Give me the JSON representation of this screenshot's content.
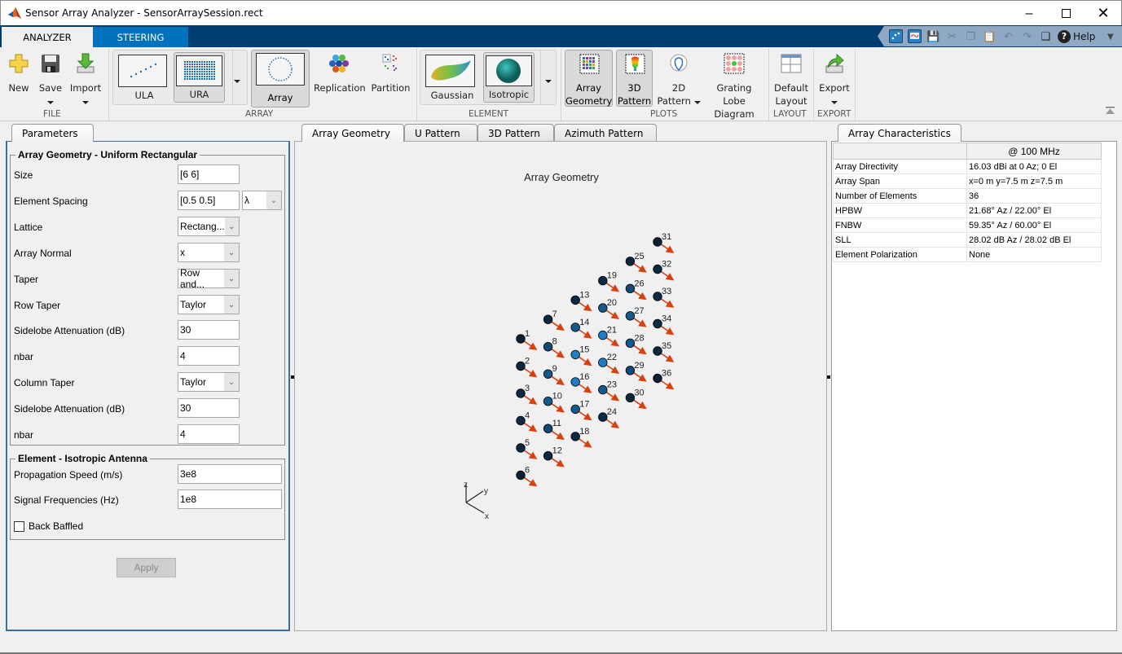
{
  "window": {
    "title": "Sensor Array Analyzer - SensorArraySession.rect",
    "minimize_icon": "minimize-icon",
    "maximize_icon": "maximize-icon",
    "close_icon": "close-icon"
  },
  "ribbon_tabs": [
    {
      "label": "ANALYZER",
      "active": true
    },
    {
      "label": "STEERING",
      "active": false
    }
  ],
  "quick_access": {
    "icons": [
      "array-geometry-plot-icon",
      "pattern-plot-icon",
      "save-icon",
      "cut-icon",
      "copy-icon",
      "paste-icon",
      "undo-icon",
      "redo-icon",
      "window-layout-icon"
    ],
    "help_label": "Help"
  },
  "ribbon": {
    "file": {
      "section": "FILE",
      "new": "New",
      "save": "Save",
      "import": "Import"
    },
    "array": {
      "section": "ARRAY",
      "gallery": [
        {
          "label": "ULA",
          "selected": false
        },
        {
          "label": "URA",
          "selected": true
        }
      ],
      "array_button": "Array",
      "replication": "Replication",
      "partition": "Partition"
    },
    "element": {
      "section": "ELEMENT",
      "gallery": [
        {
          "label": "Gaussian",
          "selected": false
        },
        {
          "label": "Isotropic",
          "selected": true
        }
      ]
    },
    "plots": {
      "section": "PLOTS",
      "array_geometry": [
        "Array",
        "Geometry"
      ],
      "pattern_3d": [
        "3D",
        "Pattern"
      ],
      "pattern_2d": [
        "2D",
        "Pattern"
      ],
      "grating_lobe": [
        "Grating Lobe",
        "Diagram"
      ]
    },
    "layout": {
      "section": "LAYOUT",
      "default_layout": [
        "Default",
        "Layout"
      ]
    },
    "export": {
      "section": "EXPORT",
      "export": "Export"
    }
  },
  "parameters": {
    "tab_label": "Parameters",
    "geometry_group": {
      "title": "Array Geometry - Uniform Rectangular",
      "rows": [
        {
          "label": "Size",
          "type": "text",
          "value": "[6 6]"
        },
        {
          "label": "Element Spacing",
          "type": "text+select",
          "value": "[0.5 0.5]",
          "unit": "λ"
        },
        {
          "label": "Lattice",
          "type": "select",
          "value": "Rectang..."
        },
        {
          "label": "Array Normal",
          "type": "select",
          "value": "x"
        },
        {
          "label": "Taper",
          "type": "select",
          "value": "Row and..."
        },
        {
          "label": "Row Taper",
          "type": "select",
          "value": "Taylor"
        },
        {
          "label": "Sidelobe Attenuation (dB)",
          "type": "text",
          "value": "30"
        },
        {
          "label": "nbar",
          "type": "text",
          "value": "4"
        },
        {
          "label": "Column Taper",
          "type": "select",
          "value": "Taylor"
        },
        {
          "label": "Sidelobe Attenuation (dB)",
          "type": "text",
          "value": "30"
        },
        {
          "label": "nbar",
          "type": "text",
          "value": "4"
        }
      ]
    },
    "element_group": {
      "title": "Element - Isotropic Antenna",
      "propagation_speed_label": "Propagation Speed (m/s)",
      "propagation_speed_value": "3e8",
      "signal_freq_label": "Signal Frequencies (Hz)",
      "signal_freq_value": "1e8",
      "back_baffled_label": "Back Baffled",
      "back_baffled_checked": false
    },
    "apply_label": "Apply"
  },
  "plot_tabs": [
    {
      "label": "Array Geometry",
      "active": true
    },
    {
      "label": "U Pattern",
      "active": false
    },
    {
      "label": "3D Pattern",
      "active": false
    },
    {
      "label": "Azimuth Pattern",
      "active": false
    }
  ],
  "geometry_plot": {
    "title": "Array Geometry",
    "axes_labels": {
      "x": "x",
      "y": "y",
      "z": "z"
    },
    "elements": [
      {
        "id": 1,
        "col": 0,
        "row": 0,
        "color": "#0a1f33"
      },
      {
        "id": 2,
        "col": 0,
        "row": 1,
        "color": "#0b2740"
      },
      {
        "id": 3,
        "col": 0,
        "row": 2,
        "color": "#0c2a45"
      },
      {
        "id": 4,
        "col": 0,
        "row": 3,
        "color": "#0c2a45"
      },
      {
        "id": 5,
        "col": 0,
        "row": 4,
        "color": "#0b2740"
      },
      {
        "id": 6,
        "col": 0,
        "row": 5,
        "color": "#0a1f33"
      },
      {
        "id": 7,
        "col": 1,
        "row": 0,
        "color": "#0b2740"
      },
      {
        "id": 8,
        "col": 1,
        "row": 1,
        "color": "#104a75"
      },
      {
        "id": 9,
        "col": 1,
        "row": 2,
        "color": "#135a8c"
      },
      {
        "id": 10,
        "col": 1,
        "row": 3,
        "color": "#135a8c"
      },
      {
        "id": 11,
        "col": 1,
        "row": 4,
        "color": "#104a75"
      },
      {
        "id": 12,
        "col": 1,
        "row": 5,
        "color": "#0b2740"
      },
      {
        "id": 13,
        "col": 2,
        "row": 0,
        "color": "#0c2a45"
      },
      {
        "id": 14,
        "col": 2,
        "row": 1,
        "color": "#135a8c"
      },
      {
        "id": 15,
        "col": 2,
        "row": 2,
        "color": "#1d7ec4"
      },
      {
        "id": 16,
        "col": 2,
        "row": 3,
        "color": "#1d7ec4"
      },
      {
        "id": 17,
        "col": 2,
        "row": 4,
        "color": "#135a8c"
      },
      {
        "id": 18,
        "col": 2,
        "row": 5,
        "color": "#0c2a45"
      },
      {
        "id": 19,
        "col": 3,
        "row": 0,
        "color": "#0c2a45"
      },
      {
        "id": 20,
        "col": 3,
        "row": 1,
        "color": "#135a8c"
      },
      {
        "id": 21,
        "col": 3,
        "row": 2,
        "color": "#1d7ec4"
      },
      {
        "id": 22,
        "col": 3,
        "row": 3,
        "color": "#1d7ec4"
      },
      {
        "id": 23,
        "col": 3,
        "row": 4,
        "color": "#135a8c"
      },
      {
        "id": 24,
        "col": 3,
        "row": 5,
        "color": "#0c2a45"
      },
      {
        "id": 25,
        "col": 4,
        "row": 0,
        "color": "#0b2740"
      },
      {
        "id": 26,
        "col": 4,
        "row": 1,
        "color": "#104a75"
      },
      {
        "id": 27,
        "col": 4,
        "row": 2,
        "color": "#135a8c"
      },
      {
        "id": 28,
        "col": 4,
        "row": 3,
        "color": "#135a8c"
      },
      {
        "id": 29,
        "col": 4,
        "row": 4,
        "color": "#104a75"
      },
      {
        "id": 30,
        "col": 4,
        "row": 5,
        "color": "#0b2740"
      },
      {
        "id": 31,
        "col": 5,
        "row": 0,
        "color": "#0a1f33"
      },
      {
        "id": 32,
        "col": 5,
        "row": 1,
        "color": "#0b2740"
      },
      {
        "id": 33,
        "col": 5,
        "row": 2,
        "color": "#0c2a45"
      },
      {
        "id": 34,
        "col": 5,
        "row": 3,
        "color": "#0c2a45"
      },
      {
        "id": 35,
        "col": 5,
        "row": 4,
        "color": "#0b2740"
      },
      {
        "id": 36,
        "col": 5,
        "row": 5,
        "color": "#0a1f33"
      }
    ],
    "normal_arrow_color": "#d9400f"
  },
  "characteristics": {
    "tab_label": "Array Characteristics",
    "column_header": "@ 100 MHz",
    "rows": [
      {
        "name": "Array Directivity",
        "value": "16.03 dBi at 0 Az; 0 El"
      },
      {
        "name": "Array Span",
        "value": "x=0 m y=7.5 m z=7.5 m"
      },
      {
        "name": "Number of Elements",
        "value": "36"
      },
      {
        "name": "HPBW",
        "value": "21.68° Az / 22.00° El"
      },
      {
        "name": "FNBW",
        "value": "59.35° Az / 60.00° El"
      },
      {
        "name": "SLL",
        "value": "28.02 dB Az / 28.02 dB El"
      },
      {
        "name": "Element Polarization",
        "value": "None"
      }
    ]
  },
  "colors": {
    "ribbon_dark": "#003e72",
    "ribbon_tab_blue": "#0072bd",
    "panel_border": "#3a6ea5"
  }
}
